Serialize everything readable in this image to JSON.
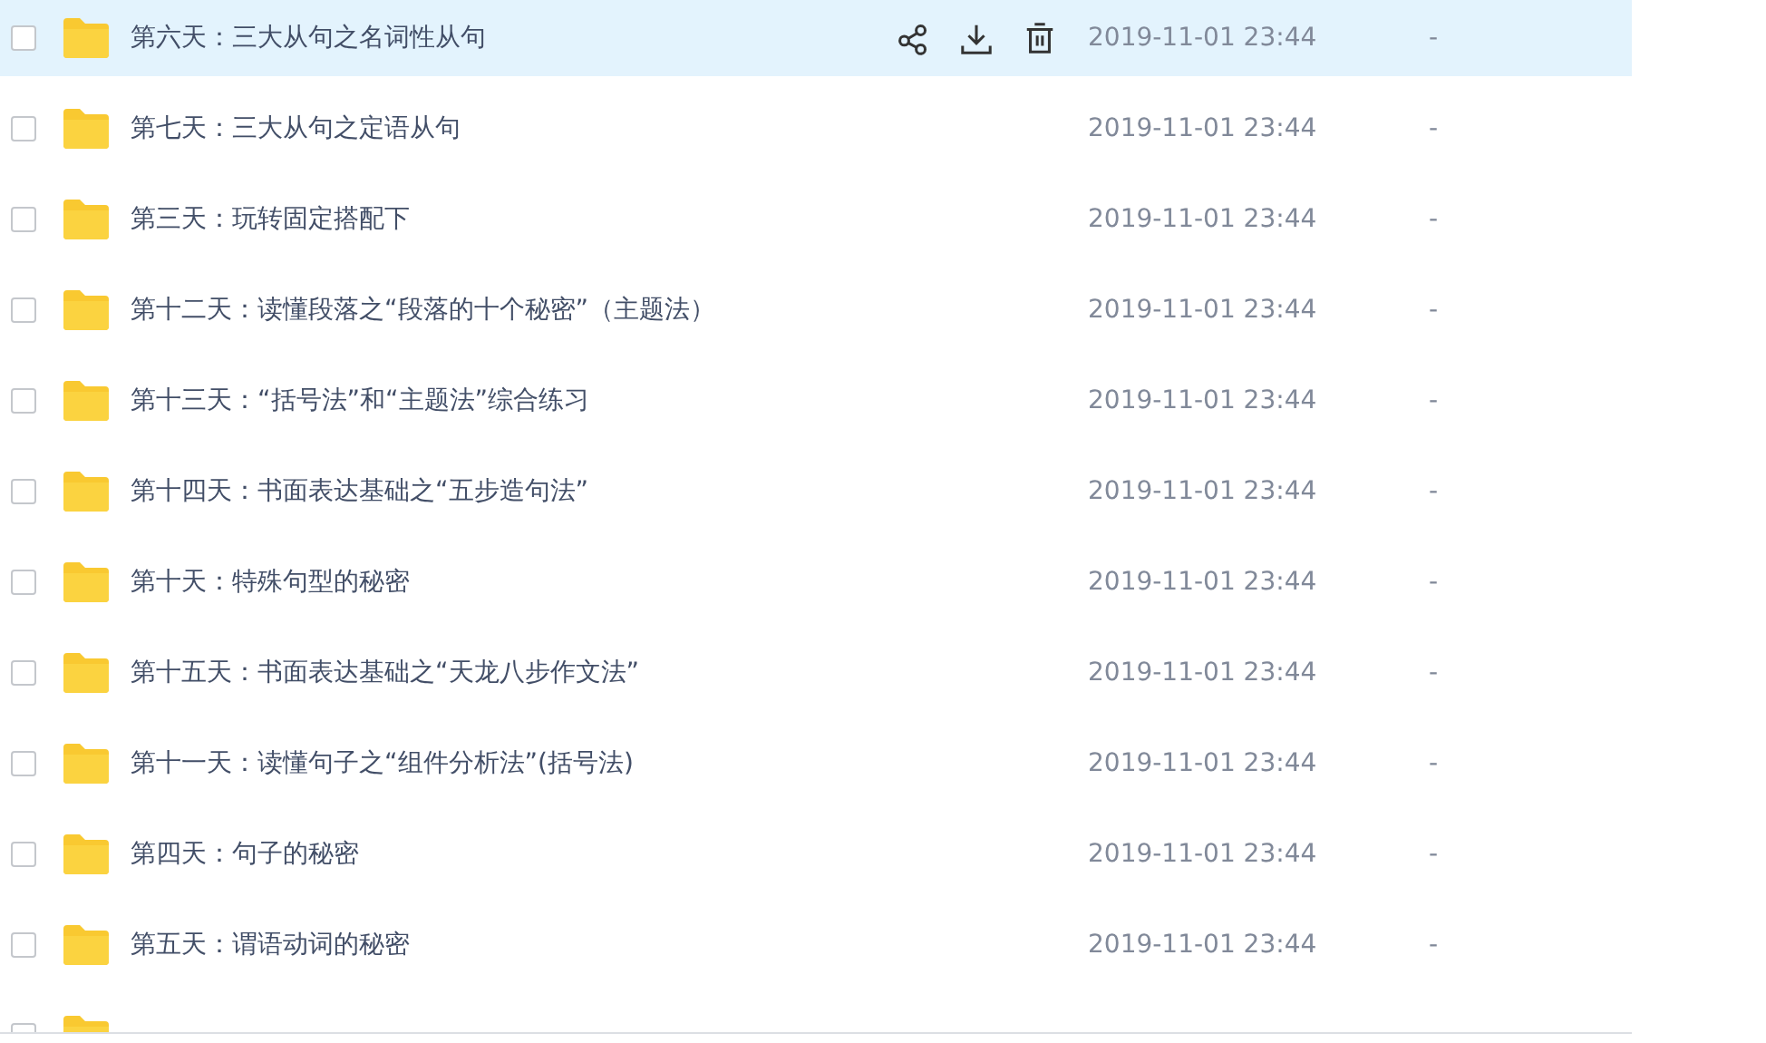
{
  "files": [
    {
      "name": "第六天：三大从句之名词性从句",
      "modified": "2019-11-01 23:44",
      "size": "-",
      "checked": false,
      "hovered": true
    },
    {
      "name": "第七天：三大从句之定语从句",
      "modified": "2019-11-01 23:44",
      "size": "-",
      "checked": false,
      "hovered": false
    },
    {
      "name": "第三天：玩转固定搭配下",
      "modified": "2019-11-01 23:44",
      "size": "-",
      "checked": false,
      "hovered": false
    },
    {
      "name": "第十二天：读懂段落之“段落的十个秘密”（主题法）",
      "modified": "2019-11-01 23:44",
      "size": "-",
      "checked": false,
      "hovered": false
    },
    {
      "name": "第十三天：“括号法”和“主题法”综合练习",
      "modified": "2019-11-01 23:44",
      "size": "-",
      "checked": false,
      "hovered": false
    },
    {
      "name": "第十四天：书面表达基础之“五步造句法”",
      "modified": "2019-11-01 23:44",
      "size": "-",
      "checked": false,
      "hovered": false
    },
    {
      "name": "第十天：特殊句型的秘密",
      "modified": "2019-11-01 23:44",
      "size": "-",
      "checked": false,
      "hovered": false
    },
    {
      "name": "第十五天：书面表达基础之“天龙八步作文法”",
      "modified": "2019-11-01 23:44",
      "size": "-",
      "checked": false,
      "hovered": false
    },
    {
      "name": "第十一天：读懂句子之“组件分析法”(括号法)",
      "modified": "2019-11-01 23:44",
      "size": "-",
      "checked": false,
      "hovered": false
    },
    {
      "name": "第四天：句子的秘密",
      "modified": "2019-11-01 23:44",
      "size": "-",
      "checked": false,
      "hovered": false
    },
    {
      "name": "第五天：谓语动词的秘密",
      "modified": "2019-11-01 23:44",
      "size": "-",
      "checked": false,
      "hovered": false
    },
    {
      "checked": false,
      "hovered": false
    }
  ]
}
